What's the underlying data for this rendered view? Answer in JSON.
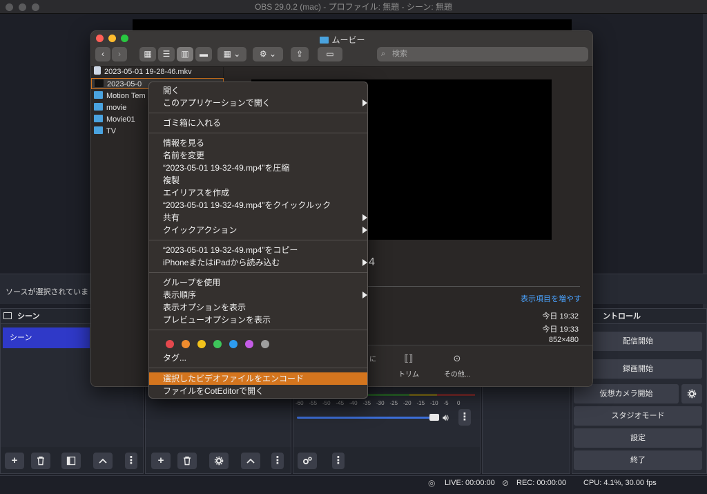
{
  "obs": {
    "title": "OBS 29.0.2 (mac) - プロファイル: 無題 - シーン: 無題",
    "no_source": "ソースが選択されていま",
    "scenes_header": "シーン",
    "scene_item": "シーン",
    "controls_header": "ントロール",
    "controls": [
      "配信開始",
      "録画開始",
      "仮想カメラ開始",
      "スタジオモード",
      "設定",
      "終了"
    ],
    "status": {
      "live": "LIVE: 00:00:00",
      "rec": "REC: 00:00:00",
      "cpu": "CPU: 4.1%, 30.00 fps"
    },
    "meter_ticks": [
      "-60",
      "-55",
      "-50",
      "-45",
      "-40",
      "-35",
      "-30",
      "-25",
      "-20",
      "-15",
      "-10",
      "-5",
      "0"
    ]
  },
  "finder": {
    "title": "ムービー",
    "search_placeholder": "検索",
    "files": [
      {
        "name": "2023-05-01 19-28-46.mkv",
        "kind": "mkv"
      },
      {
        "name": "2023-05-0",
        "kind": "video",
        "selected": true
      },
      {
        "name": "Motion Tem",
        "kind": "folder"
      },
      {
        "name": "movie",
        "kind": "folder"
      },
      {
        "name": "Movie01",
        "kind": "folder"
      },
      {
        "name": "TV",
        "kind": "folder"
      }
    ],
    "preview_partial": "4",
    "more_link": "表示項目を増やす",
    "meta": [
      "今日 19:32",
      "今日 19:33",
      "852×480"
    ],
    "actions": [
      "に",
      "トリム",
      "その他..."
    ]
  },
  "menu": {
    "items": [
      "開く",
      "このアプリケーションで開く",
      "ゴミ箱に入れる",
      "情報を見る",
      "名前を変更",
      "“2023-05-01 19-32-49.mp4”を圧縮",
      "複製",
      "エイリアスを作成",
      "“2023-05-01 19-32-49.mp4”をクイックルック",
      "共有",
      "クイックアクション",
      "“2023-05-01 19-32-49.mp4”をコピー",
      "iPhoneまたはiPadから読み込む",
      "グループを使用",
      "表示順序",
      "表示オプションを表示",
      "プレビューオプションを表示",
      "タグ...",
      "選択したビデオファイルをエンコード",
      "ファイルをCotEditorで開く"
    ],
    "tag_colors": [
      "#e5484d",
      "#f08c2e",
      "#f2c21b",
      "#3ec55a",
      "#2d9cf0",
      "#c45ce6",
      "#9e9e9e"
    ]
  }
}
